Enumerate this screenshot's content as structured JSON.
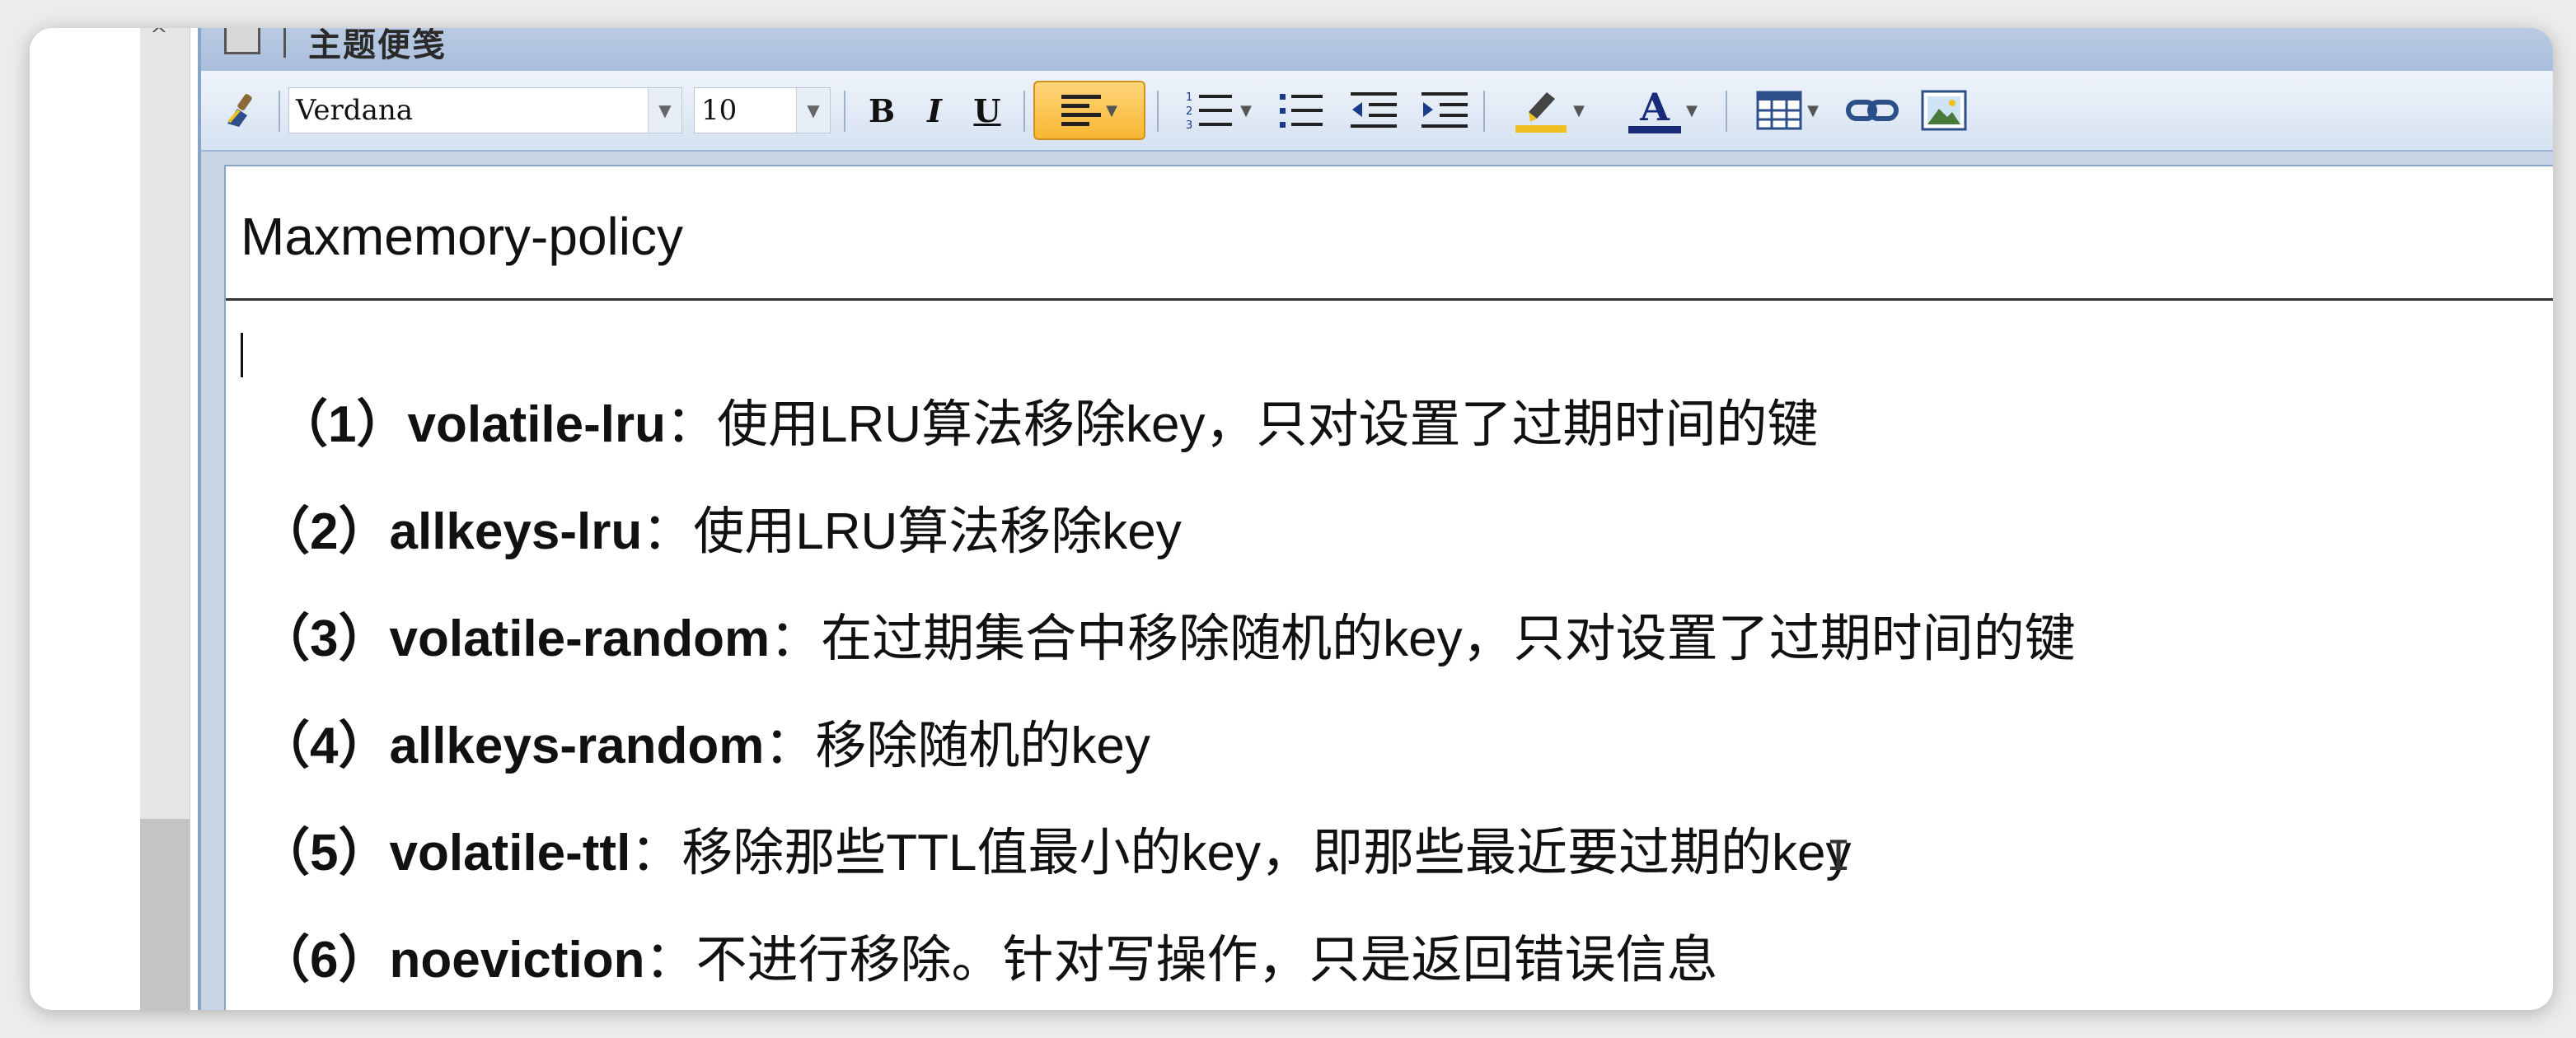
{
  "window": {
    "title": "主题便笺"
  },
  "toolbar": {
    "font_name": "Verdana",
    "font_size": "10",
    "bold_label": "B",
    "italic_label": "I",
    "underline_label": "U",
    "text_color_label": "A",
    "highlight_color": "#f0c020",
    "font_color": "#1a2a7a",
    "accent_color": "#f7b733"
  },
  "document": {
    "title": "Maxmemory-policy",
    "items": [
      {
        "num": "（1）",
        "name": "volatile-lru",
        "desc": "：使用LRU算法移除key，只对设置了过期时间的键"
      },
      {
        "num": "（2）",
        "name": "allkeys-lru",
        "desc": "：使用LRU算法移除key"
      },
      {
        "num": "（3）",
        "name": "volatile-random",
        "desc": "：在过期集合中移除随机的key，只对设置了过期时间的键"
      },
      {
        "num": "（4）",
        "name": "allkeys-random",
        "desc": "：移除随机的key"
      },
      {
        "num": "（5）",
        "name": "volatile-ttl",
        "desc": "：移除那些TTL值最小的key，即那些最近要过期的key"
      },
      {
        "num": "（6）",
        "name": "noeviction",
        "desc": "：不进行移除。针对写操作，只是返回错误信息"
      }
    ]
  }
}
